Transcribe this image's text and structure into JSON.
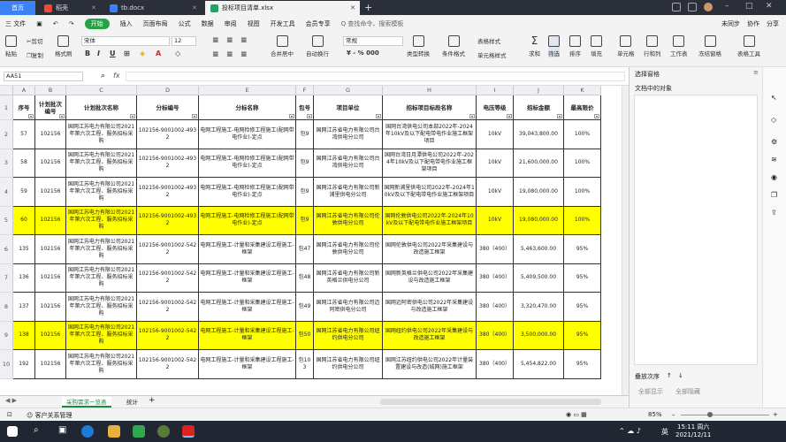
{
  "tabs": [
    {
      "label": "首页"
    },
    {
      "label": "稻壳"
    },
    {
      "label": "tb.docx"
    },
    {
      "label": "投标项目清单.xlsx"
    }
  ],
  "menu": {
    "file": "三 文件",
    "start": "开始",
    "items": [
      "插入",
      "页面布局",
      "公式",
      "数据",
      "审阅",
      "视图",
      "开发工具",
      "会员专享"
    ],
    "search_placeholder": "Q 查找命令、搜索模板",
    "right": [
      "未同步",
      "协作",
      "分享"
    ]
  },
  "ribbon": {
    "paste": "粘贴",
    "cut": "剪切",
    "copy": "复制",
    "format_painter": "格式刷",
    "font_name": "宋体",
    "font_size": "12",
    "merge": "合并居中",
    "wrap": "自动换行",
    "number_format": "常规",
    "type_convert": "类型转换",
    "cond_format": "条件格式",
    "table_style": "表格样式",
    "cell_style": "单元格样式",
    "sum": "求和",
    "filter": "筛选",
    "sort": "排序",
    "fill": "填充",
    "cell": "单元格",
    "rowcol": "行和列",
    "worksheet": "工作表",
    "freeze": "冻结窗格",
    "tabletools": "表格工具"
  },
  "formula_bar": {
    "name_box": "AA51",
    "fx": "fx"
  },
  "columns": [
    {
      "letter": "A"
    },
    {
      "letter": "B"
    },
    {
      "letter": "C"
    },
    {
      "letter": "D"
    },
    {
      "letter": "E"
    },
    {
      "letter": "F"
    },
    {
      "letter": "G"
    },
    {
      "letter": "H"
    },
    {
      "letter": "I"
    },
    {
      "letter": "J"
    },
    {
      "letter": "K"
    }
  ],
  "header_row": {
    "rownum": "1",
    "cells": [
      "序号",
      "计划批次编号",
      "计划批次名称",
      "分标编号",
      "分标名称",
      "包号",
      "项目单位",
      "招标项目标段名称",
      "电压等级",
      "招标金额",
      "最高限价"
    ]
  },
  "rows": [
    {
      "rownum": "2",
      "cells": [
        "57",
        "102156",
        "国网江苏电力有限公司2021年第六次工程、服务招标采购",
        "102156-9001002-4932",
        "电网工程施工-电网检修工程施工(配网带电作业)-定点",
        "包9",
        "国网江苏省电力有限公司台湾供电分公司",
        "国网台湾供电公司本部2022年-2024年10kV及以下配电带电作业施工框架项目",
        "10kV",
        "39,043,800.00",
        "100%"
      ]
    },
    {
      "rownum": "3",
      "cells": [
        "58",
        "102156",
        "国网江苏电力有限公司2021年第六次工程、服务招标采购",
        "102156-9001002-4932",
        "电网工程施工-电网检修工程施工(配网带电作业)-定点",
        "包9",
        "国网江苏省电力有限公司台湾供电分公司",
        "国网台湾日月潭供电公司2022年-2024年10kV及以下配电带电作业施工框架项目",
        "10kV",
        "21,600,000.00",
        "100%"
      ]
    },
    {
      "rownum": "4",
      "cells": [
        "59",
        "102156",
        "国网江苏电力有限公司2021年第六次工程、服务招标采购",
        "102156-9001002-4932",
        "电网工程施工-电网检修工程施工(配网带电作业)-定点",
        "包9",
        "国网江苏省电力有限公司新浦里供电分公司",
        "国网新浦里供电公司2022年-2024年10kV及以下配电带电作业施工框架项目",
        "10kV",
        "19,080,000.00",
        "100%"
      ]
    },
    {
      "rownum": "5",
      "cells": [
        "60",
        "102156",
        "国网江苏电力有限公司2021年第六次工程、服务招标采购",
        "102156-9001002-4932",
        "电网工程施工-电网检修工程施工(配网带电作业)-定点",
        "包9",
        "国网江苏省电力有限公司伦敦供电分公司",
        "国网伦敦供电公司2022年-2024年10kV及以下配电带电作业施工框架项目",
        "10kV",
        "19,080,000.00",
        "100%"
      ],
      "highlight": true
    },
    {
      "rownum": "6",
      "cells": [
        "135",
        "102156",
        "国网江苏电力有限公司2021年第六次工程、服务招标采购",
        "102156-9001002-5422",
        "电网工程施工-计量和采集建设工程施工-框架",
        "包47",
        "国网江苏省电力有限公司伦敦供电分公司",
        "国网伦敦供电公司2022年采集建设与改造施工框架",
        "380（400）",
        "5,463,600.00",
        "95%"
      ]
    },
    {
      "rownum": "7",
      "cells": [
        "136",
        "102156",
        "国网江苏电力有限公司2021年第六次工程、服务招标采购",
        "102156-9001002-5422",
        "电网工程施工-计量和采集建设工程施工-框架",
        "包48",
        "国网江苏省电力有限公司新英格兰供电分公司",
        "国网新英格兰供电公司2022年采集建设与改造施工框架",
        "380（400）",
        "5,409,500.00",
        "95%"
      ]
    },
    {
      "rownum": "8",
      "cells": [
        "137",
        "102156",
        "国网江苏电力有限公司2021年第六次工程、服务招标采购",
        "102156-9001002-5422",
        "电网工程施工-计量和采集建设工程施工-框架",
        "包49",
        "国网江苏省电力有限公司迈阿密供电分公司",
        "国网迈阿密供电公司2022年采集建设与改造施工框架",
        "380（400）",
        "3,320,470.00",
        "95%"
      ]
    },
    {
      "rownum": "9",
      "cells": [
        "138",
        "102156",
        "国网江苏电力有限公司2021年第六次工程、服务招标采购",
        "102156-9001002-5422",
        "电网工程施工-计量和采集建设工程施工-框架",
        "包50",
        "国网江苏省电力有限公司纽约供电分公司",
        "国网纽约供电公司2022年采集建设与改造施工框架",
        "380（400）",
        "3,500,000.00",
        "95%"
      ],
      "highlight": true
    },
    {
      "rownum": "10",
      "cells": [
        "192",
        "102156",
        "国网江苏电力有限公司2021年第六次工程、服务招标采购",
        "102156-9001002-5422",
        "电网工程施工-计量和采集建设工程施工-框架",
        "包103",
        "国网江苏省电力有限公司纽约供电分公司",
        "国网江苏纽约供电公司2022年计量装置建设与改造(城网)施工框架",
        "380（400）",
        "5,454,822.00",
        "95%"
      ]
    }
  ],
  "sheets": {
    "active": "采购需求一览表",
    "other": "统计"
  },
  "status": {
    "left": "客户关系管理",
    "zoom": "85%"
  },
  "pane": {
    "title": "选择窗格",
    "sub": "文档中的对象",
    "order": "叠放次序",
    "show_all": "全部显示",
    "hide_all": "全部隐藏"
  },
  "taskbar": {
    "time": "15:11 周六",
    "date": "2021/12/11",
    "lang": "英"
  }
}
